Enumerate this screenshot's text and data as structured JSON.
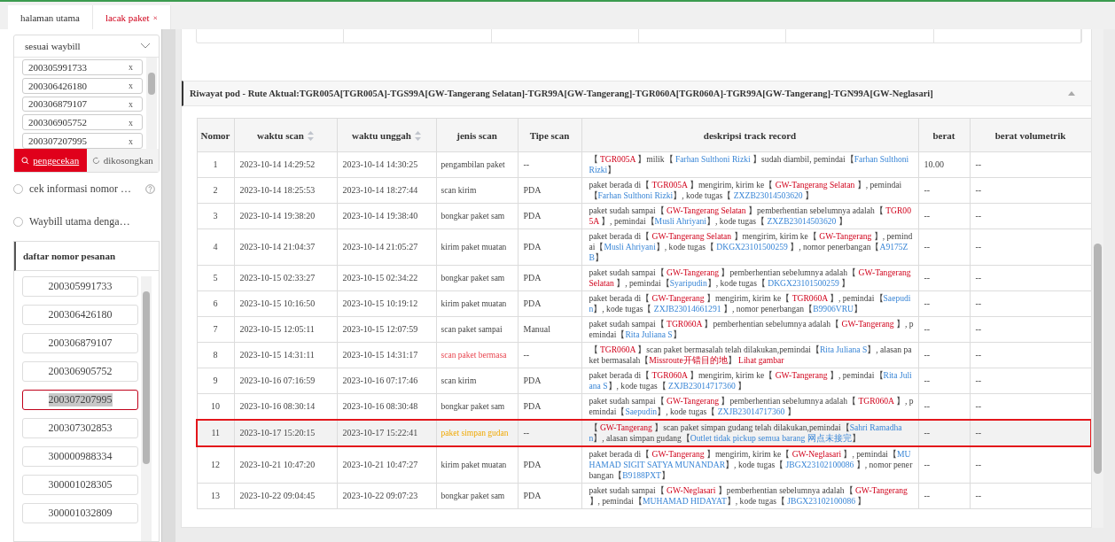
{
  "tabs": [
    {
      "label": "halaman utama",
      "selected": false
    },
    {
      "label": "lacak paket",
      "selected": true,
      "close": "×"
    }
  ],
  "search": {
    "mode": "sesuai waybill",
    "waybills": [
      {
        "number": "200305991733",
        "remove": "x"
      },
      {
        "number": "200306426180",
        "remove": "x"
      },
      {
        "number": "200306879107",
        "remove": "x"
      },
      {
        "number": "200306905752",
        "remove": "x"
      },
      {
        "number": "200307207995",
        "remove": "x"
      }
    ],
    "buttons": [
      {
        "label": "pengecekan",
        "kind": "primary"
      },
      {
        "label": "dikosongkan",
        "kind": "reset"
      }
    ],
    "options": [
      {
        "label": "cek informasi nomor …",
        "checked": false,
        "help": true
      },
      {
        "label": "Waybill utama denga…",
        "checked": false,
        "help": false
      }
    ]
  },
  "order_list": {
    "title": "daftar nomor pesanan",
    "items": [
      {
        "number": "200305991733",
        "selected": false
      },
      {
        "number": "200306426180",
        "selected": false
      },
      {
        "number": "200306879107",
        "selected": false
      },
      {
        "number": "200306905752",
        "selected": false
      },
      {
        "number": "200307207995",
        "selected": true
      },
      {
        "number": "200307302853",
        "selected": false
      },
      {
        "number": "300000988334",
        "selected": false
      },
      {
        "number": "300001028305",
        "selected": false
      },
      {
        "number": "300001032809",
        "selected": false
      }
    ]
  },
  "history": {
    "title": "Riwayat pod - Rute Aktual:TGR005A[TGR005A]-TGS99A[GW-Tangerang Selatan]-TGR99A[GW-Tangerang]-TGR060A[TGR060A]-TGR99A[GW-Tangerang]-TGN99A[GW-Neglasari]",
    "expanded": true,
    "columns": [
      {
        "label": "Nomor",
        "sortable": false
      },
      {
        "label": "waktu scan",
        "sortable": true
      },
      {
        "label": "waktu unggah",
        "sortable": true
      },
      {
        "label": "jenis scan",
        "sortable": false
      },
      {
        "label": "Tipe scan",
        "sortable": false
      },
      {
        "label": "deskripsi track record",
        "sortable": false
      },
      {
        "label": "berat",
        "sortable": false
      },
      {
        "label": "berat volumetrik",
        "sortable": false
      }
    ],
    "rows": [
      {
        "no": "1",
        "scan_time": "2023-10-14 14:29:52",
        "upload_time": "2023-10-14 14:30:25",
        "scan_kind": "pengambilan paket",
        "kind": "normal",
        "scan_type": "--",
        "weight": "10.00",
        "volumetric": "--",
        "marked": false,
        "description": [
          {
            "text": "【 ",
            "kind": "plain"
          },
          {
            "text": "TGR005A",
            "kind": "place"
          },
          {
            "text": " 】milik【 ",
            "kind": "plain"
          },
          {
            "text": "Farhan Sulthoni Rizki",
            "kind": "link"
          },
          {
            "text": " 】sudah diambil,  pemindai【",
            "kind": "plain"
          },
          {
            "text": "Farhan Sulthoni Rizki",
            "kind": "link"
          },
          {
            "text": "】",
            "kind": "plain"
          }
        ]
      },
      {
        "no": "2",
        "scan_time": "2023-10-14 18:25:53",
        "upload_time": "2023-10-14 18:27:44",
        "scan_kind": "scan kirim",
        "kind": "normal",
        "scan_type": "PDA",
        "weight": "--",
        "volumetric": "--",
        "marked": false,
        "description": [
          {
            "text": "paket berada di【 ",
            "kind": "plain"
          },
          {
            "text": "TGR005A",
            "kind": "place"
          },
          {
            "text": " 】mengirim, kirim ke【 ",
            "kind": "plain"
          },
          {
            "text": "GW-Tangerang Selatan",
            "kind": "place"
          },
          {
            "text": " 】,  pemindai【",
            "kind": "plain"
          },
          {
            "text": "Farhan Sulthoni Rizki",
            "kind": "link"
          },
          {
            "text": "】,  kode tugas【 ",
            "kind": "plain"
          },
          {
            "text": "ZXZB23014503620",
            "kind": "link"
          },
          {
            "text": " 】",
            "kind": "plain"
          }
        ]
      },
      {
        "no": "3",
        "scan_time": "2023-10-14 19:38:20",
        "upload_time": "2023-10-14 19:38:40",
        "scan_kind": "bongkar paket sam",
        "kind": "normal",
        "scan_type": "PDA",
        "weight": "--",
        "volumetric": "--",
        "marked": false,
        "description": [
          {
            "text": "paket sudah sampai【 ",
            "kind": "plain"
          },
          {
            "text": "GW-Tangerang Selatan",
            "kind": "place"
          },
          {
            "text": " 】pemberhentian sebelumnya adalah【 ",
            "kind": "plain"
          },
          {
            "text": "TGR005A",
            "kind": "place"
          },
          {
            "text": " 】,  pemindai【",
            "kind": "plain"
          },
          {
            "text": "Musli Ahriyani",
            "kind": "link"
          },
          {
            "text": "】,  kode tugas【 ",
            "kind": "plain"
          },
          {
            "text": "ZXZB23014503620",
            "kind": "link"
          },
          {
            "text": " 】",
            "kind": "plain"
          }
        ]
      },
      {
        "no": "4",
        "scan_time": "2023-10-14 21:04:37",
        "upload_time": "2023-10-14 21:05:27",
        "scan_kind": "kirim paket muatan",
        "kind": "normal",
        "scan_type": "PDA",
        "weight": "--",
        "volumetric": "--",
        "marked": false,
        "description": [
          {
            "text": "paket berada di【 ",
            "kind": "plain"
          },
          {
            "text": "GW-Tangerang Selatan",
            "kind": "place"
          },
          {
            "text": " 】mengirim, kirim ke【 ",
            "kind": "plain"
          },
          {
            "text": "GW-Tangerang",
            "kind": "place"
          },
          {
            "text": " 】,  pemindai【",
            "kind": "plain"
          },
          {
            "text": "Musli Ahriyani",
            "kind": "link"
          },
          {
            "text": "】,  kode tugas【 ",
            "kind": "plain"
          },
          {
            "text": "DKGX23101500259",
            "kind": "link"
          },
          {
            "text": " 】,  nomor penerbangan【",
            "kind": "plain"
          },
          {
            "text": "A9175ZB",
            "kind": "link"
          },
          {
            "text": "】",
            "kind": "plain"
          }
        ]
      },
      {
        "no": "5",
        "scan_time": "2023-10-15 02:33:27",
        "upload_time": "2023-10-15 02:34:22",
        "scan_kind": "bongkar paket sam",
        "kind": "normal",
        "scan_type": "PDA",
        "weight": "--",
        "volumetric": "--",
        "marked": false,
        "description": [
          {
            "text": "paket sudah sampai【 ",
            "kind": "plain"
          },
          {
            "text": "GW-Tangerang",
            "kind": "place"
          },
          {
            "text": " 】pemberhentian sebelumnya adalah【 ",
            "kind": "plain"
          },
          {
            "text": "GW-Tangerang Selatan",
            "kind": "place"
          },
          {
            "text": " 】,  pemindai【",
            "kind": "plain"
          },
          {
            "text": "Syaripudin",
            "kind": "link"
          },
          {
            "text": "】,  kode tugas【 ",
            "kind": "plain"
          },
          {
            "text": "DKGX23101500259",
            "kind": "link"
          },
          {
            "text": " 】",
            "kind": "plain"
          }
        ]
      },
      {
        "no": "6",
        "scan_time": "2023-10-15 10:16:50",
        "upload_time": "2023-10-15 10:19:12",
        "scan_kind": "kirim paket muatan",
        "kind": "normal",
        "scan_type": "PDA",
        "weight": "--",
        "volumetric": "--",
        "marked": false,
        "description": [
          {
            "text": "paket berada di【 ",
            "kind": "plain"
          },
          {
            "text": "GW-Tangerang",
            "kind": "place"
          },
          {
            "text": " 】mengirim, kirim ke【 ",
            "kind": "plain"
          },
          {
            "text": "TGR060A",
            "kind": "place"
          },
          {
            "text": " 】,  pemindai【",
            "kind": "plain"
          },
          {
            "text": "Saepudin",
            "kind": "link"
          },
          {
            "text": "】,  kode tugas【 ",
            "kind": "plain"
          },
          {
            "text": "ZXJB23014661291",
            "kind": "link"
          },
          {
            "text": " 】,  nomor penerbangan【",
            "kind": "plain"
          },
          {
            "text": "B9906VRU",
            "kind": "link"
          },
          {
            "text": "】",
            "kind": "plain"
          }
        ]
      },
      {
        "no": "7",
        "scan_time": "2023-10-15 12:05:11",
        "upload_time": "2023-10-15 12:07:59",
        "scan_kind": "scan paket sampai",
        "kind": "normal",
        "scan_type": "Manual",
        "weight": "--",
        "volumetric": "--",
        "marked": false,
        "description": [
          {
            "text": "paket sudah sampai【 ",
            "kind": "plain"
          },
          {
            "text": "TGR060A",
            "kind": "place"
          },
          {
            "text": " 】pemberhentian sebelumnya adalah【 ",
            "kind": "plain"
          },
          {
            "text": "GW-Tangerang",
            "kind": "place"
          },
          {
            "text": " 】,  pemindai【",
            "kind": "plain"
          },
          {
            "text": "Rita Juliana S",
            "kind": "link"
          },
          {
            "text": "】",
            "kind": "plain"
          }
        ]
      },
      {
        "no": "8",
        "scan_time": "2023-10-15 14:31:11",
        "upload_time": "2023-10-15 14:31:17",
        "scan_kind": "scan paket bermasa",
        "kind": "problem",
        "scan_type": "--",
        "weight": "--",
        "volumetric": "--",
        "marked": false,
        "description": [
          {
            "text": "【 ",
            "kind": "plain"
          },
          {
            "text": "TGR060A",
            "kind": "place"
          },
          {
            "text": " 】scan paket bermasalah telah dilakukan,pemindai【",
            "kind": "plain"
          },
          {
            "text": "Rita Juliana S",
            "kind": "link"
          },
          {
            "text": "】,  alasan paket bermasalah【",
            "kind": "plain"
          },
          {
            "text": "Missroute开错目的地",
            "kind": "place"
          },
          {
            "text": "】  ",
            "kind": "plain"
          },
          {
            "text": "Lihat gambar",
            "kind": "place"
          }
        ]
      },
      {
        "no": "9",
        "scan_time": "2023-10-16 07:16:59",
        "upload_time": "2023-10-16 07:17:46",
        "scan_kind": "scan kirim",
        "kind": "normal",
        "scan_type": "PDA",
        "weight": "--",
        "volumetric": "--",
        "marked": false,
        "description": [
          {
            "text": "paket berada di【 ",
            "kind": "plain"
          },
          {
            "text": "TGR060A",
            "kind": "place"
          },
          {
            "text": " 】mengirim, kirim ke【 ",
            "kind": "plain"
          },
          {
            "text": "GW-Tangerang",
            "kind": "place"
          },
          {
            "text": " 】,  pemindai【",
            "kind": "plain"
          },
          {
            "text": "Rita Juliana S",
            "kind": "link"
          },
          {
            "text": "】,  kode tugas【 ",
            "kind": "plain"
          },
          {
            "text": "ZXJB23014717360",
            "kind": "link"
          },
          {
            "text": " 】",
            "kind": "plain"
          }
        ]
      },
      {
        "no": "10",
        "scan_time": "2023-10-16 08:30:14",
        "upload_time": "2023-10-16 08:30:48",
        "scan_kind": "bongkar paket sam",
        "kind": "normal",
        "scan_type": "PDA",
        "weight": "--",
        "volumetric": "--",
        "marked": false,
        "description": [
          {
            "text": "paket sudah sampai【 ",
            "kind": "plain"
          },
          {
            "text": "GW-Tangerang",
            "kind": "place"
          },
          {
            "text": " 】pemberhentian sebelumnya adalah【 ",
            "kind": "plain"
          },
          {
            "text": "TGR060A",
            "kind": "place"
          },
          {
            "text": " 】,  pemindai【",
            "kind": "plain"
          },
          {
            "text": "Saepudin",
            "kind": "link"
          },
          {
            "text": "】,  kode tugas【 ",
            "kind": "plain"
          },
          {
            "text": "ZXJB23014717360",
            "kind": "link"
          },
          {
            "text": " 】",
            "kind": "plain"
          }
        ]
      },
      {
        "no": "11",
        "scan_time": "2023-10-17 15:20:15",
        "upload_time": "2023-10-17 15:22:41",
        "scan_kind": "paket simpan gudan",
        "kind": "storage",
        "scan_type": "--",
        "weight": "--",
        "volumetric": "--",
        "marked": true,
        "description": [
          {
            "text": "【 ",
            "kind": "plain"
          },
          {
            "text": "GW-Tangerang",
            "kind": "place"
          },
          {
            "text": " 】scan paket simpan gudang telah dilakukan,pemindai【",
            "kind": "plain"
          },
          {
            "text": "Sahri Ramadhan",
            "kind": "link"
          },
          {
            "text": "】,  alasan simpan gudang【",
            "kind": "plain"
          },
          {
            "text": "Outlet tidak pickup semua barang 网点未接完",
            "kind": "link"
          },
          {
            "text": "】",
            "kind": "plain"
          }
        ]
      },
      {
        "no": "12",
        "scan_time": "2023-10-21 10:47:20",
        "upload_time": "2023-10-21 10:47:27",
        "scan_kind": "kirim paket muatan",
        "kind": "normal",
        "scan_type": "PDA",
        "weight": "--",
        "volumetric": "--",
        "marked": false,
        "description": [
          {
            "text": "paket berada di【 ",
            "kind": "plain"
          },
          {
            "text": "GW-Tangerang",
            "kind": "place"
          },
          {
            "text": " 】mengirim, kirim ke【 ",
            "kind": "plain"
          },
          {
            "text": "GW-Neglasari",
            "kind": "place"
          },
          {
            "text": " 】,  pemindai【",
            "kind": "plain"
          },
          {
            "text": "MUHAMAD SIGIT SATYA MUNANDAR",
            "kind": "link"
          },
          {
            "text": "】,  kode tugas【 ",
            "kind": "plain"
          },
          {
            "text": "JBGX23102100086",
            "kind": "link"
          },
          {
            "text": " 】,  nomor penerbangan【",
            "kind": "plain"
          },
          {
            "text": "B9188PXT",
            "kind": "link"
          },
          {
            "text": "】",
            "kind": "plain"
          }
        ]
      },
      {
        "no": "13",
        "scan_time": "2023-10-22 09:04:45",
        "upload_time": "2023-10-22 09:07:23",
        "scan_kind": "bongkar paket sam",
        "kind": "normal",
        "scan_type": "PDA",
        "weight": "--",
        "volumetric": "--",
        "marked": false,
        "description": [
          {
            "text": "paket sudah sampai【 ",
            "kind": "plain"
          },
          {
            "text": "GW-Neglasari",
            "kind": "place"
          },
          {
            "text": " 】pemberhentian sebelumnya adalah【 ",
            "kind": "plain"
          },
          {
            "text": "GW-Tangerang",
            "kind": "place"
          },
          {
            "text": " 】,  pemindai【",
            "kind": "plain"
          },
          {
            "text": "MUHAMAD HIDAYAT",
            "kind": "link"
          },
          {
            "text": "】,  kode tugas【 ",
            "kind": "plain"
          },
          {
            "text": "JBGX23102100086",
            "kind": "link"
          },
          {
            "text": " 】",
            "kind": "plain"
          }
        ]
      }
    ]
  }
}
